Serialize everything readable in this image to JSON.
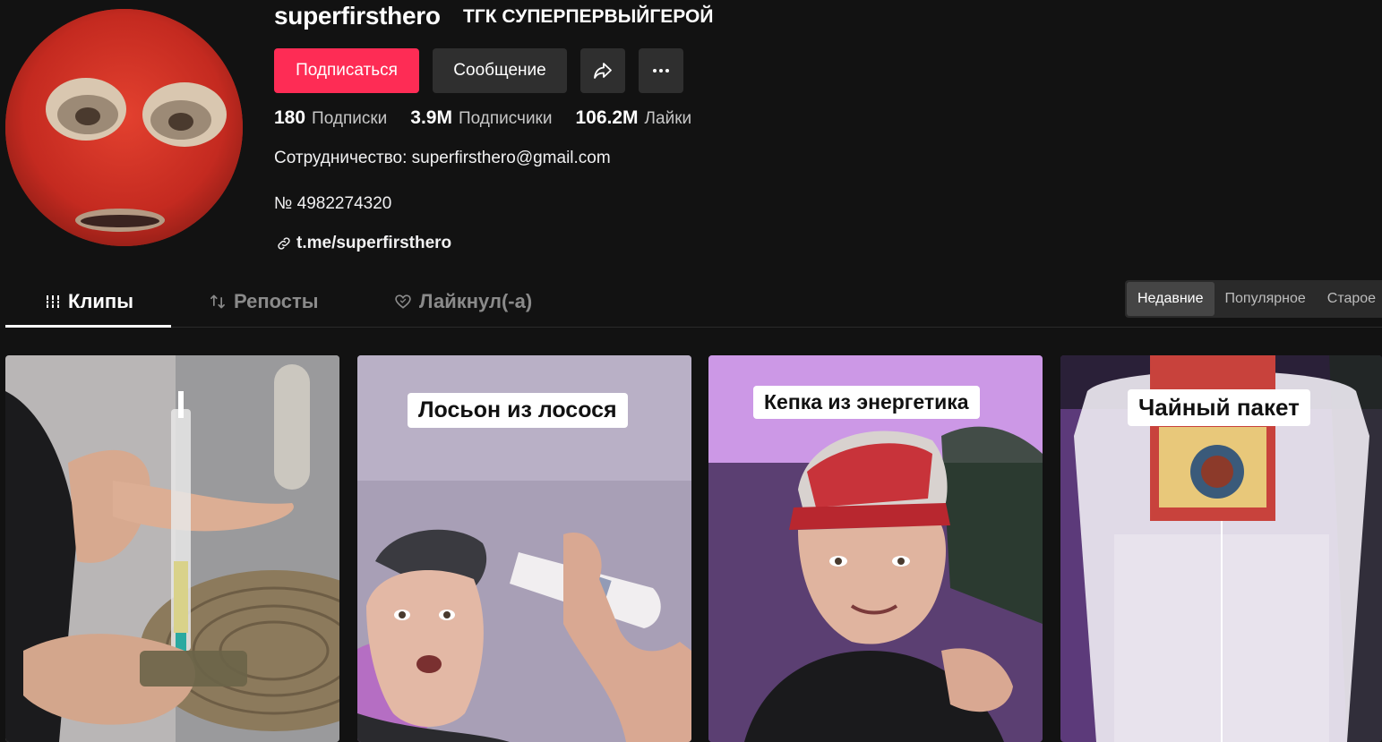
{
  "profile": {
    "username": "superfirsthero",
    "nickname": "ТГК СУПЕРПЕРВЫЙГЕРОЙ"
  },
  "actions": {
    "follow_label": "Подписаться",
    "message_label": "Сообщение",
    "share_icon": "share-icon",
    "more_icon": "more-icon"
  },
  "stats": {
    "following": {
      "value": "180",
      "label": "Подписки"
    },
    "followers": {
      "value": "3.9M",
      "label": "Подписчики"
    },
    "likes": {
      "value": "106.2M",
      "label": "Лайки"
    }
  },
  "bio": {
    "line1": "Сотрудничество: superfirsthero@gmail.com",
    "line2": "№ 4982274320",
    "link": "t.me/superfirsthero"
  },
  "tabs": [
    {
      "label": "Клипы",
      "icon": "grid-icon",
      "active": true
    },
    {
      "label": "Репосты",
      "icon": "repost-icon",
      "active": false
    },
    {
      "label": "Лайкнул(-а)",
      "icon": "liked-heart-icon",
      "active": false
    }
  ],
  "sort": [
    {
      "label": "Недавние",
      "active": true
    },
    {
      "label": "Популярное",
      "active": false
    },
    {
      "label": "Старое",
      "active": false
    }
  ],
  "videos": [
    {
      "caption": ""
    },
    {
      "caption": "Лосьон из лосося"
    },
    {
      "caption": "Кепка  из энергетика"
    },
    {
      "caption": "Чайный пакет"
    }
  ],
  "colors": {
    "accent": "#fe2c55",
    "background": "#121212",
    "button_dark": "#2f2f2f"
  }
}
